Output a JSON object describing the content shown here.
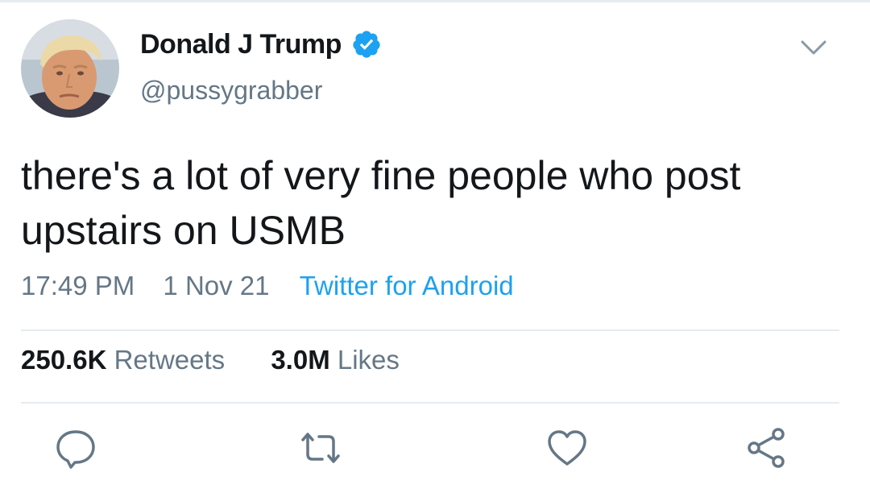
{
  "user": {
    "display_name": "Donald J Trump",
    "handle": "@pussygrabber",
    "verified_icon": "verified-badge-icon"
  },
  "tweet": {
    "text": "there's a lot of very fine people who post upstairs on USMB",
    "time": "17:49 PM",
    "date": "1 Nov 21",
    "client": "Twitter for Android"
  },
  "stats": {
    "retweets_count": "250.6K",
    "retweets_label": "Retweets",
    "likes_count": "3.0M",
    "likes_label": "Likes"
  },
  "actions": [
    "reply-icon",
    "retweet-icon",
    "like-icon",
    "share-icon"
  ],
  "colors": {
    "text": "#14171a",
    "secondary": "#657786",
    "accent": "#1da1f2",
    "divider": "#e6ecf0"
  }
}
